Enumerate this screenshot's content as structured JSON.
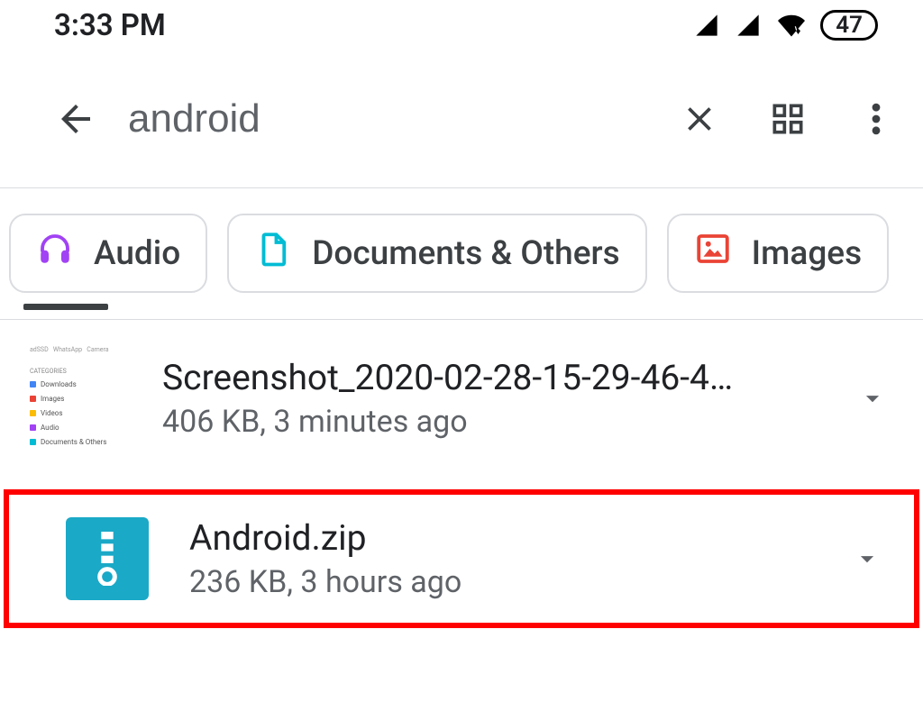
{
  "status": {
    "time": "3:33 PM",
    "battery_level": "47"
  },
  "app_bar": {
    "search_value": "android"
  },
  "chips": {
    "audio": "Audio",
    "documents": "Documents & Others",
    "images": "Images"
  },
  "results": [
    {
      "name": "Screenshot_2020-02-28-15-29-46-4…",
      "meta": "406 KB, 3 minutes ago"
    },
    {
      "name": "Android.zip",
      "meta": "236 KB, 3 hours ago"
    }
  ]
}
